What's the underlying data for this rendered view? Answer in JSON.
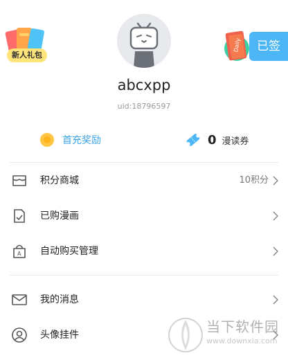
{
  "header": {
    "gift_badge": "新人礼包",
    "username": "abcxpp",
    "uid": "uid:18796597",
    "daily_label": "Daily",
    "signed_label": "已签"
  },
  "rewards": {
    "recharge_label": "首充奖励",
    "ticket_count": "0",
    "ticket_label": "漫读券"
  },
  "menu": [
    {
      "label": "积分商城",
      "value": "10积分",
      "icon": "store-icon"
    },
    {
      "label": "已购漫画",
      "value": "",
      "icon": "purchased-icon"
    },
    {
      "label": "自动购买管理",
      "value": "",
      "icon": "auto-buy-icon"
    },
    {
      "label": "我的消息",
      "value": "",
      "icon": "mail-icon"
    },
    {
      "label": "头像挂件",
      "value": "",
      "icon": "avatar-frame-icon"
    }
  ],
  "watermark": {
    "title": "当下软件园",
    "url": "www.downxia.com"
  },
  "colors": {
    "accent": "#3ea5e8",
    "signed_bg": "#4db6f5",
    "coin": "#ffc542",
    "gift_label_bg": "#ffe47a",
    "divider": "#e9e9e9"
  }
}
